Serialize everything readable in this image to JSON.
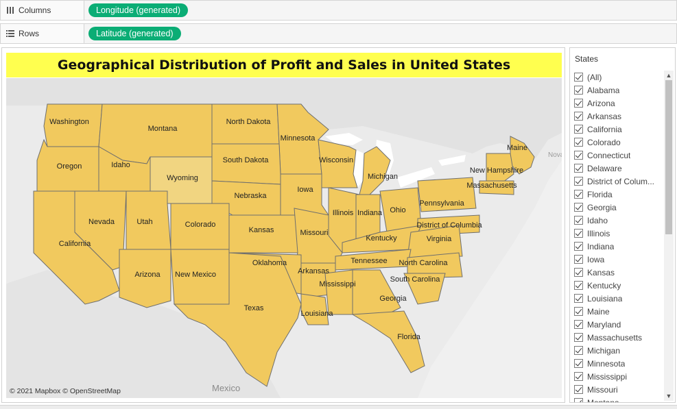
{
  "shelves": {
    "columns_label": "Columns",
    "columns_pill": "Longitude (generated)",
    "rows_label": "Rows",
    "rows_pill": "Latitude (generated)",
    "pill_color": "#0bad75"
  },
  "map": {
    "title": "Geographical Distribution of Profit and Sales in United States",
    "title_bg": "#ffff4f",
    "state_fill": "#f1c95e",
    "highlight_fill": "#f1d581",
    "attribution": "© 2021 Mapbox © OpenStreetMap",
    "basemap_labels": [
      "Mexico",
      "Nova"
    ],
    "state_labels": [
      "Washington",
      "Montana",
      "North Dakota",
      "Minnesota",
      "Maine",
      "Oregon",
      "Idaho",
      "Wyoming",
      "South Dakota",
      "Wisconsin",
      "Michigan",
      "New Hampshire",
      "Massachusetts",
      "Iowa",
      "Nebraska",
      "Nevada",
      "Utah",
      "Colorado",
      "Kansas",
      "Illinois",
      "Indiana",
      "Ohio",
      "Pennsylvania",
      "District of Columbia",
      "Missouri",
      "Kentucky",
      "Virginia",
      "California",
      "Oklahoma",
      "Tennessee",
      "North Carolina",
      "Arkansas",
      "Arizona",
      "New Mexico",
      "South Carolina",
      "Mississippi",
      "Georgia",
      "Texas",
      "Louisiana",
      "Florida"
    ]
  },
  "filter": {
    "title": "States",
    "items": [
      "(All)",
      "Alabama",
      "Arizona",
      "Arkansas",
      "California",
      "Colorado",
      "Connecticut",
      "Delaware",
      "District of Colum...",
      "Florida",
      "Georgia",
      "Idaho",
      "Illinois",
      "Indiana",
      "Iowa",
      "Kansas",
      "Kentucky",
      "Louisiana",
      "Maine",
      "Maryland",
      "Massachusetts",
      "Michigan",
      "Minnesota",
      "Mississippi",
      "Missouri",
      "Montana"
    ]
  }
}
